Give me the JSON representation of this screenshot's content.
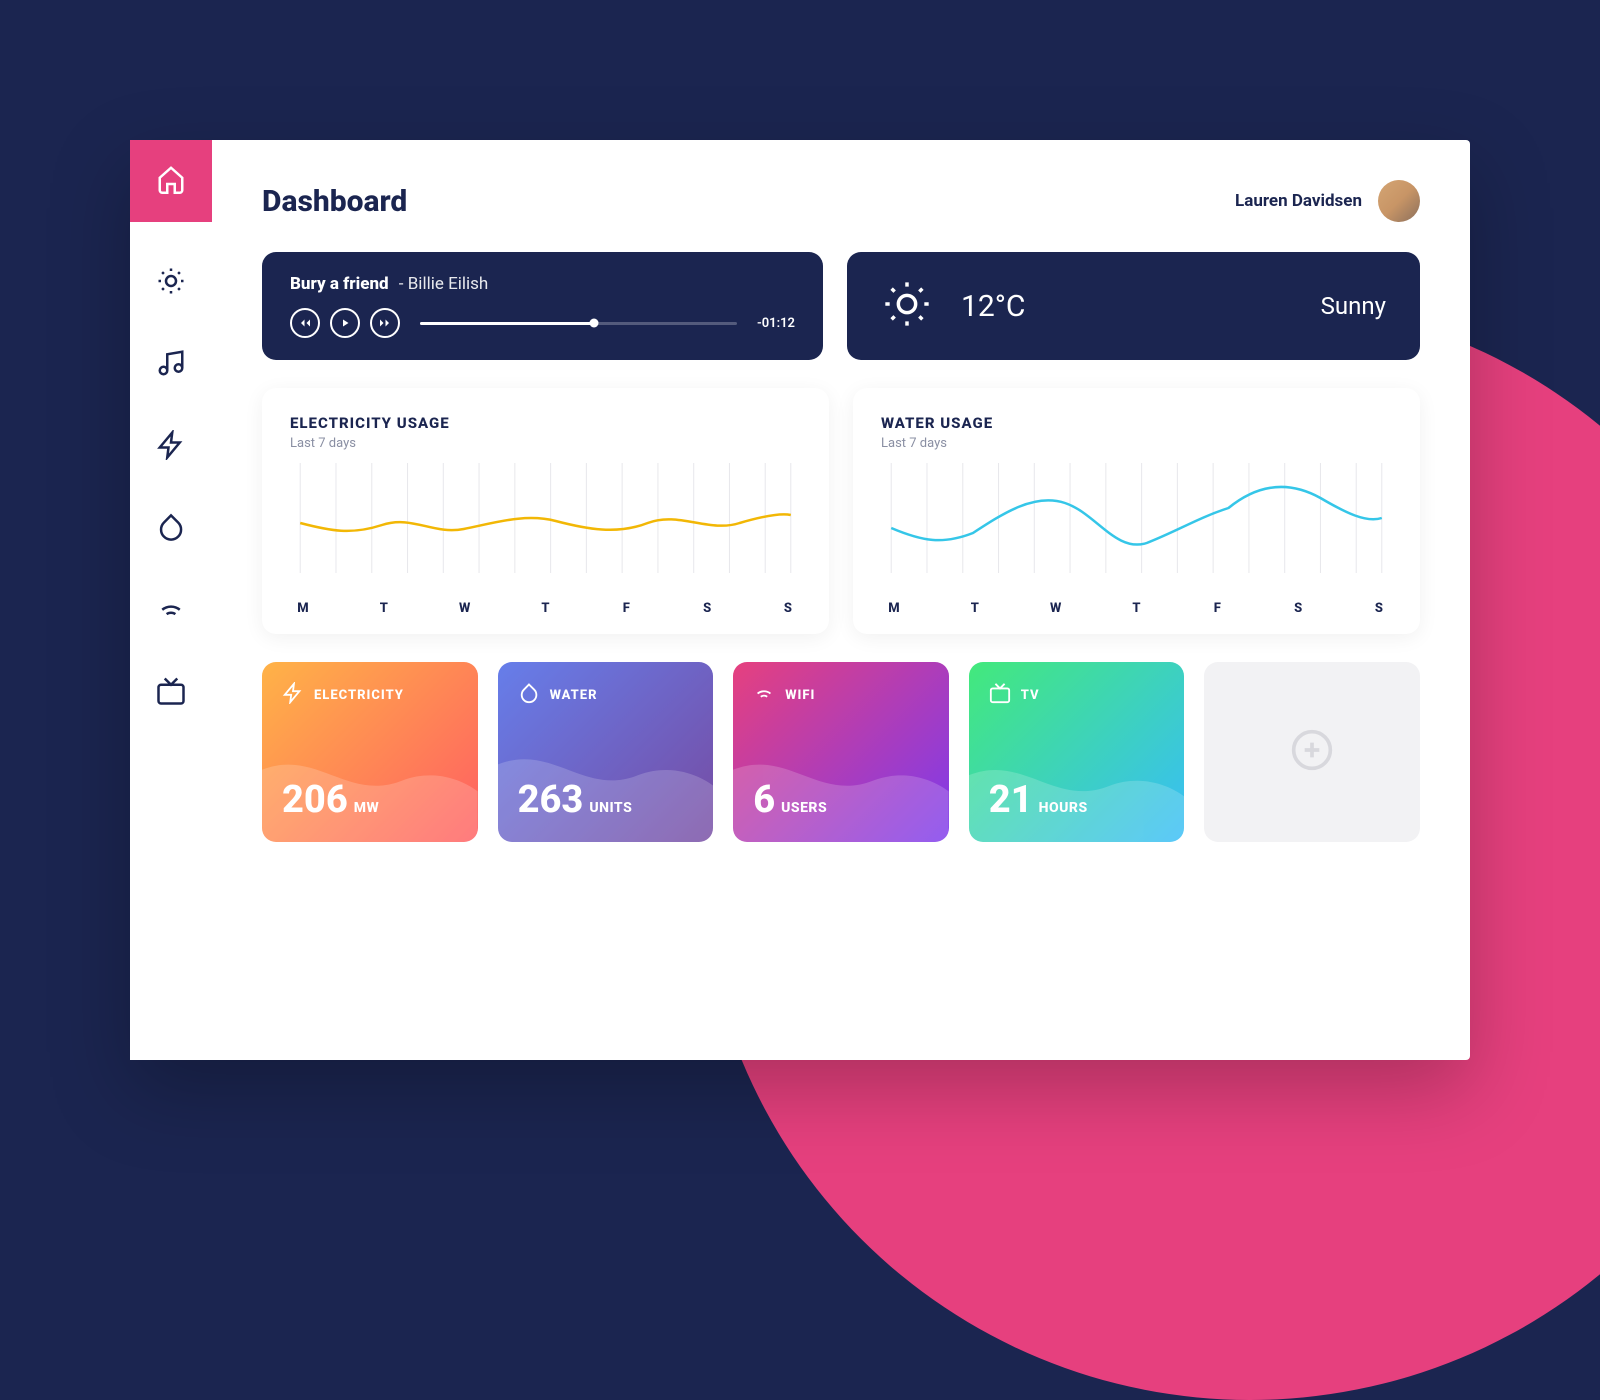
{
  "header": {
    "title": "Dashboard"
  },
  "user": {
    "name": "Lauren Davidsen"
  },
  "sidebar": {
    "items": [
      {
        "icon": "home",
        "active": true
      },
      {
        "icon": "sun",
        "active": false
      },
      {
        "icon": "music",
        "active": false
      },
      {
        "icon": "bolt",
        "active": false
      },
      {
        "icon": "droplet",
        "active": false
      },
      {
        "icon": "wifi",
        "active": false
      },
      {
        "icon": "tv",
        "active": false
      }
    ]
  },
  "music": {
    "song": "Bury a friend",
    "artist": "Billie Eilish",
    "time_remaining": "-01:12",
    "progress_pct": 55
  },
  "weather": {
    "temperature": "12°C",
    "condition": "Sunny"
  },
  "usage": {
    "electricity": {
      "title": "ELECTRICITY USAGE",
      "subtitle": "Last 7 days"
    },
    "water": {
      "title": "WATER USAGE",
      "subtitle": "Last 7 days"
    },
    "day_labels": [
      "M",
      "T",
      "W",
      "T",
      "F",
      "S",
      "S"
    ]
  },
  "tiles": {
    "electricity": {
      "label": "ELECTRICITY",
      "value": "206",
      "unit": "MW"
    },
    "water": {
      "label": "WATER",
      "value": "263",
      "unit": "UNITS"
    },
    "wifi": {
      "label": "WIFI",
      "value": "6",
      "unit": "USERS"
    },
    "tv": {
      "label": "TV",
      "value": "21",
      "unit": "HOURS"
    }
  },
  "chart_data": [
    {
      "type": "line",
      "title": "ELECTRICITY USAGE",
      "subtitle": "Last 7 days",
      "categories": [
        "M",
        "T",
        "W",
        "T",
        "F",
        "S",
        "S"
      ],
      "values": [
        48,
        44,
        55,
        45,
        56,
        46,
        55
      ],
      "ylim": [
        0,
        100
      ],
      "color": "#f2b705"
    },
    {
      "type": "line",
      "title": "WATER USAGE",
      "subtitle": "Last 7 days",
      "categories": [
        "M",
        "T",
        "W",
        "T",
        "F",
        "S",
        "S"
      ],
      "values": [
        45,
        35,
        72,
        30,
        50,
        82,
        58
      ],
      "ylim": [
        0,
        100
      ],
      "color": "#35c6e8"
    }
  ]
}
